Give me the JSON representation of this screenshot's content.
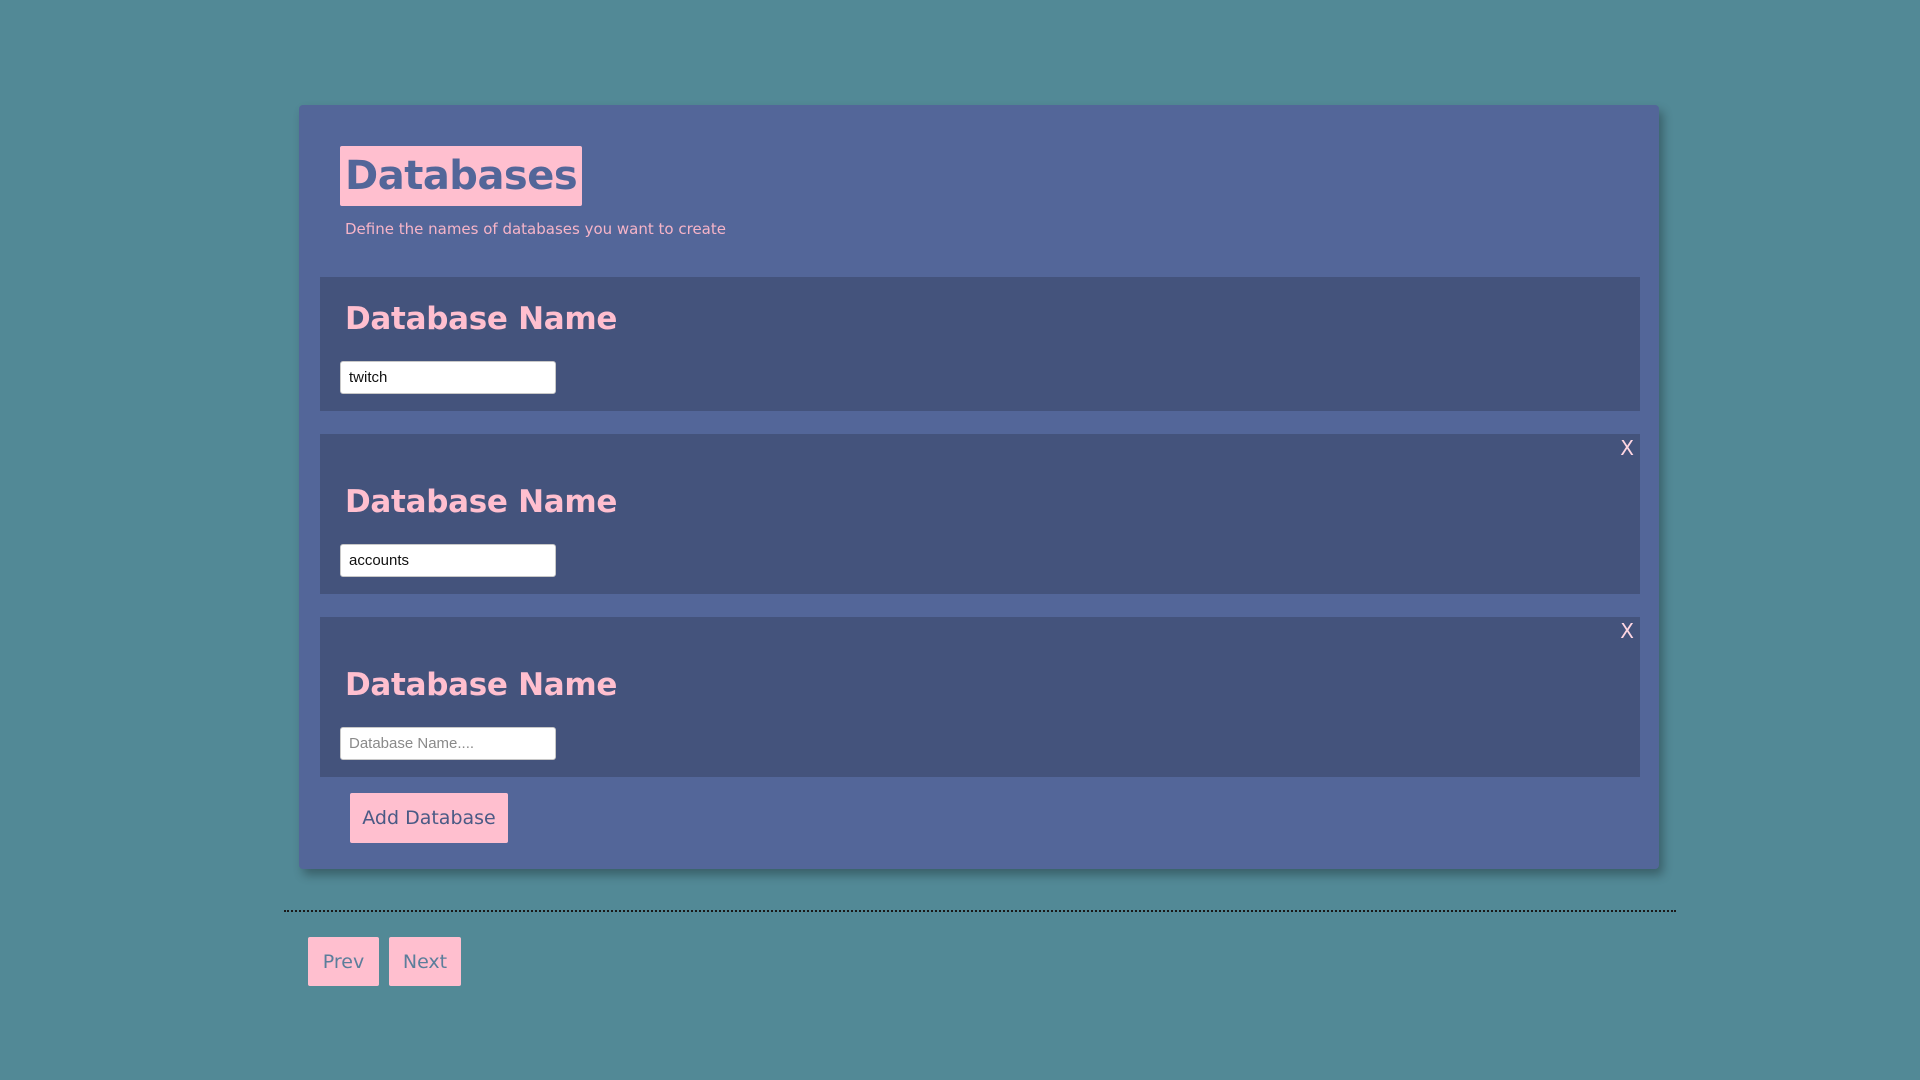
{
  "header": {
    "title": "Databases",
    "subtitle": "Define the names of databases you want to create"
  },
  "databases": [
    {
      "label": "Database Name",
      "value": "twitch",
      "placeholder": "Database Name....",
      "removable": false
    },
    {
      "label": "Database Name",
      "value": "accounts",
      "placeholder": "Database Name....",
      "removable": true,
      "remove_label": "X"
    },
    {
      "label": "Database Name",
      "value": "",
      "placeholder": "Database Name....",
      "removable": true,
      "remove_label": "X"
    }
  ],
  "actions": {
    "add_label": "Add Database"
  },
  "nav": {
    "prev_label": "Prev",
    "next_label": "Next"
  },
  "colors": {
    "background": "#528996",
    "panel": "#536699",
    "card": "#44537c",
    "accent_pink": "#ffbfcf"
  }
}
